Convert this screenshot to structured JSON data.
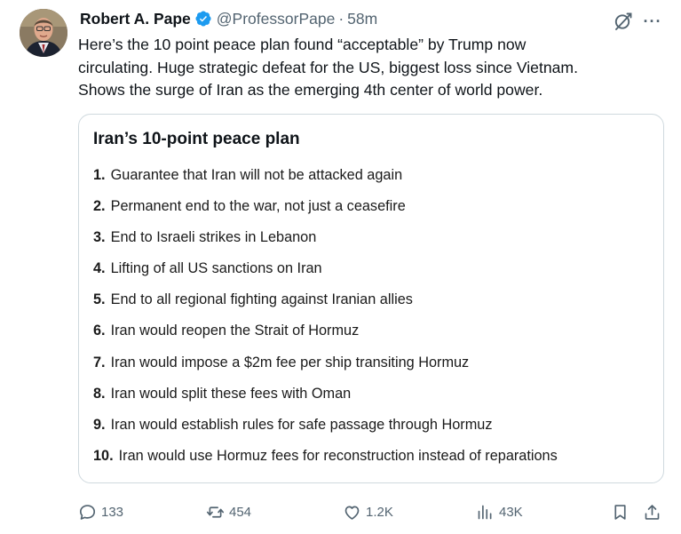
{
  "tweet": {
    "author_name": "Robert A. Pape",
    "handle": "@ProfessorPape",
    "separator": "·",
    "time": "58m",
    "more": "···",
    "text_lines": [
      "Here’s the 10 point peace plan found “acceptable” by Trump now",
      "circulating.  Huge strategic defeat for the US, biggest loss since Vietnam.",
      "Shows the surge of Iran as the emerging 4th center of world power."
    ]
  },
  "card": {
    "title": "Iran’s 10-point peace plan",
    "items": [
      {
        "num": "1.",
        "text": "Guarantee that Iran will not be attacked again"
      },
      {
        "num": "2.",
        "text": "Permanent end to the war, not just a ceasefire"
      },
      {
        "num": "3.",
        "text": "End to Israeli strikes in Lebanon"
      },
      {
        "num": "4.",
        "text": "Lifting of all US sanctions on Iran"
      },
      {
        "num": "5.",
        "text": "End to all regional fighting against Iranian allies"
      },
      {
        "num": "6.",
        "text": "Iran would reopen the Strait of Hormuz"
      },
      {
        "num": "7.",
        "text": "Iran would impose a $2m fee per ship transiting Hormuz"
      },
      {
        "num": "8.",
        "text": "Iran would split these fees with Oman"
      },
      {
        "num": "9.",
        "text": "Iran would establish rules for safe passage through Hormuz"
      },
      {
        "num": "10.",
        "text": "Iran would use Hormuz fees for reconstruction instead of reparations"
      }
    ]
  },
  "actions": {
    "replies": "133",
    "reposts": "454",
    "likes": "1.2K",
    "views": "43K"
  },
  "icons": {
    "verified": "verified-badge-icon",
    "grok": "grok-icon",
    "reply": "reply-icon",
    "repost": "repost-icon",
    "like": "like-icon",
    "views": "views-icon",
    "bookmark": "bookmark-icon",
    "share": "share-icon"
  },
  "colors": {
    "text": "#0f1419",
    "secondary": "#536471",
    "verified": "#1d9bf0",
    "card_border": "#cfd9de"
  }
}
